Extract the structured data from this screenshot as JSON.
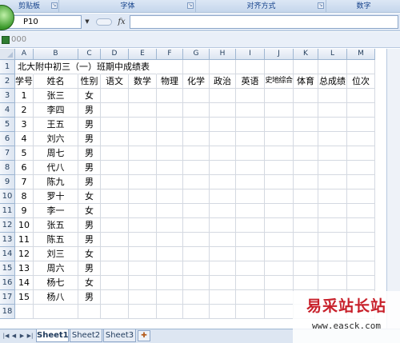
{
  "ribbon": {
    "groups": [
      "剪贴板",
      "字体",
      "对齐方式",
      "数字"
    ]
  },
  "formula_bar": {
    "name_box": "P10",
    "fx_label": "fx",
    "formula": ""
  },
  "workbook": {
    "title": "000"
  },
  "columns": [
    "A",
    "B",
    "C",
    "D",
    "E",
    "F",
    "G",
    "H",
    "I",
    "J",
    "K",
    "L",
    "M"
  ],
  "rows": [
    "1",
    "2",
    "3",
    "4",
    "5",
    "6",
    "7",
    "8",
    "9",
    "10",
    "11",
    "12",
    "13",
    "14",
    "15",
    "16",
    "17",
    "18"
  ],
  "sheet": {
    "title": "北大附中初三（一）班期中成绩表",
    "headers": [
      "学号",
      "姓名",
      "性别",
      "语文",
      "数学",
      "物理",
      "化学",
      "政治",
      "英语",
      "史地综合",
      "体育",
      "总成绩",
      "位次"
    ],
    "records": [
      [
        "1",
        "张三",
        "女"
      ],
      [
        "2",
        "李四",
        "男"
      ],
      [
        "3",
        "王五",
        "男"
      ],
      [
        "4",
        "刘六",
        "男"
      ],
      [
        "5",
        "周七",
        "男"
      ],
      [
        "6",
        "代八",
        "男"
      ],
      [
        "7",
        "陈九",
        "男"
      ],
      [
        "8",
        "罗十",
        "女"
      ],
      [
        "9",
        "李一",
        "女"
      ],
      [
        "10",
        "张五",
        "男"
      ],
      [
        "11",
        "陈五",
        "男"
      ],
      [
        "12",
        "刘三",
        "女"
      ],
      [
        "13",
        "周六",
        "男"
      ],
      [
        "14",
        "杨七",
        "女"
      ],
      [
        "15",
        "杨八",
        "男"
      ]
    ]
  },
  "tabs": [
    "Sheet1",
    "Sheet2",
    "Sheet3"
  ],
  "watermark": {
    "title": "易采站长站",
    "url": "www.easck.com"
  }
}
